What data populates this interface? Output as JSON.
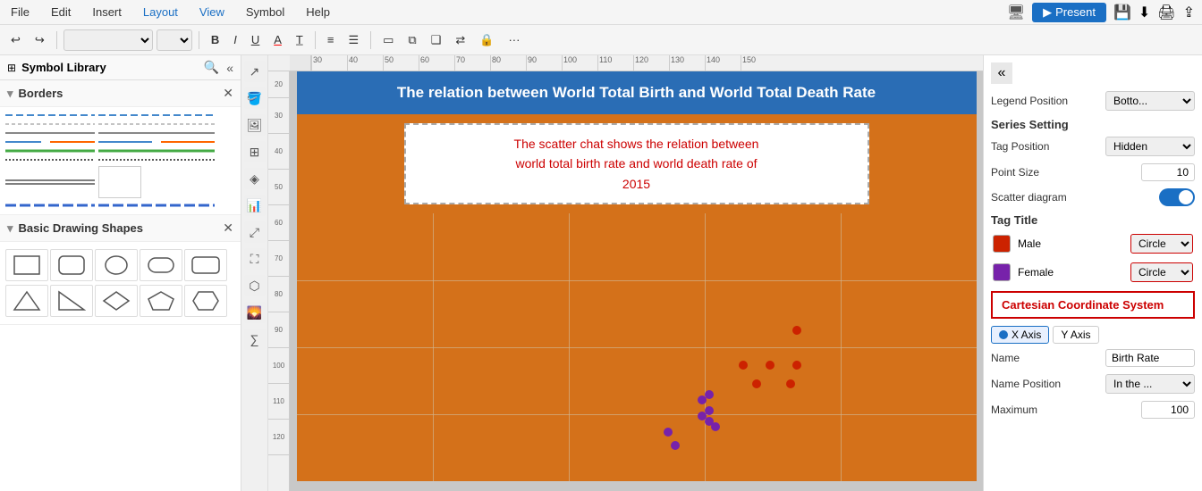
{
  "menuBar": {
    "items": [
      "File",
      "Edit",
      "Insert",
      "Layout",
      "View",
      "Symbol",
      "Help"
    ],
    "blueItems": [
      "Layout",
      "View"
    ],
    "presentLabel": "Present"
  },
  "toolbar": {
    "undoLabel": "↩",
    "redoLabel": "↪",
    "fontPlaceholder": "",
    "boldLabel": "B",
    "italicLabel": "I",
    "underlineLabel": "U",
    "fontColorLabel": "A",
    "shadowLabel": "T",
    "alignLeftLabel": "≡",
    "alignLabel": "≡",
    "borderLabel": "▭",
    "layerLabel": "❑",
    "flipLabel": "⇄"
  },
  "sidebar": {
    "title": "Symbol Library",
    "sections": [
      {
        "name": "Borders",
        "collapsed": false
      },
      {
        "name": "Basic Drawing Shapes",
        "collapsed": false
      }
    ]
  },
  "chart": {
    "title": "The relation between World Total Birth and World Total Death Rate",
    "subtitle": "The scatter chat shows the relation between\nworld total birth rate and world death rate of\n2015",
    "rulerMarks": [
      "30",
      "40",
      "50",
      "60",
      "70",
      "80",
      "90",
      "100",
      "110",
      "120",
      "130",
      "140",
      "150"
    ],
    "sideMarks": [
      "20",
      "30",
      "40",
      "50",
      "60",
      "70",
      "80",
      "90",
      "100",
      "110",
      "120"
    ]
  },
  "rightPanel": {
    "legendPositionLabel": "Legend Position",
    "legendPositionValue": "Botto...",
    "seriesSettingLabel": "Series Setting",
    "tagPositionLabel": "Tag Position",
    "tagPositionValue": "Hidden",
    "pointSizeLabel": "Point Size",
    "pointSizeValue": "10",
    "scatterDiagramLabel": "Scatter diagram",
    "tagTitleLabel": "Tag Title",
    "maleTag": {
      "label": "Male",
      "color": "#cc2200",
      "shapeValue": "Circle"
    },
    "femaleTag": {
      "label": "Female",
      "color": "#7722aa",
      "shapeValue": "Circle"
    },
    "ccsTitle": "Cartesian Coordinate System",
    "xAxisLabel": "X Axis",
    "yAxisLabel": "Y Axis",
    "nameLabel": "Name",
    "nameValue": "Birth Rate",
    "namePositionLabel": "Name Position",
    "namePositionValue": "In the ...",
    "maximumLabel": "Maximum",
    "maximumValue": "100"
  }
}
